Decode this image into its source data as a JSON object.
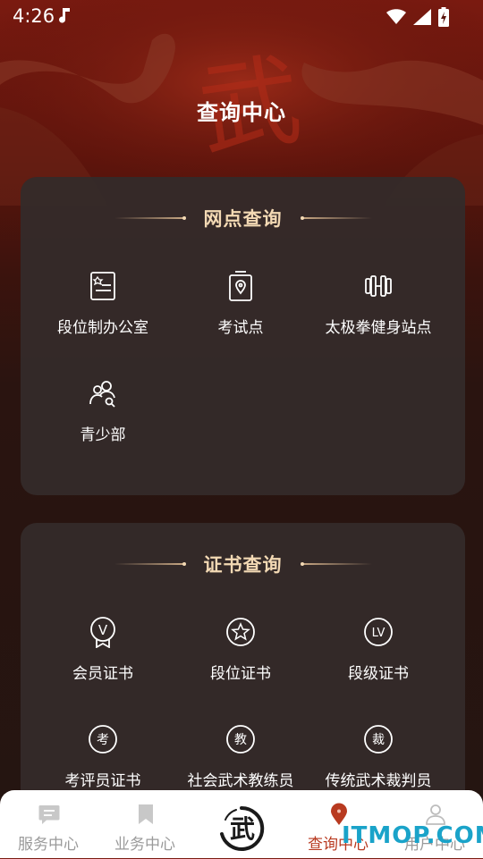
{
  "status_bar": {
    "time": "4:26"
  },
  "header": {
    "title": "查询中心"
  },
  "outlet_section": {
    "title": "网点查询",
    "items": [
      {
        "label": "段位制办公室",
        "icon": "id-card-icon"
      },
      {
        "label": "考试点",
        "icon": "location-pin-icon"
      },
      {
        "label": "太极拳健身站点",
        "icon": "dumbbell-icon"
      },
      {
        "label": "青少部",
        "icon": "youth-group-icon"
      }
    ]
  },
  "certificate_section": {
    "title": "证书查询",
    "items": [
      {
        "label": "会员证书",
        "icon": "medal-v-icon",
        "glyph": "V"
      },
      {
        "label": "段位证书",
        "icon": "star-badge-icon",
        "glyph": ""
      },
      {
        "label": "段级证书",
        "icon": "lv-badge-icon",
        "glyph": "LV"
      },
      {
        "label": "考评员证书",
        "icon": "examiner-badge-icon",
        "glyph": "考"
      },
      {
        "label": "社会武术教练员",
        "icon": "coach-badge-icon",
        "glyph": "教"
      },
      {
        "label": "传统武术裁判员",
        "icon": "referee-badge-icon",
        "glyph": "裁"
      }
    ]
  },
  "tabbar": {
    "tabs": [
      {
        "label": "服务中心",
        "icon": "chat-bubble-icon",
        "active": false
      },
      {
        "label": "业务中心",
        "icon": "bookmark-icon",
        "active": false
      },
      {
        "label": "",
        "icon": "wu-logo-icon",
        "active": false
      },
      {
        "label": "查询中心",
        "icon": "map-pin-icon",
        "active": true
      },
      {
        "label": "用户中心",
        "icon": "user-icon",
        "active": false
      }
    ],
    "center_logo_text": "武"
  },
  "background": {
    "calligraphy": "武"
  },
  "watermark": {
    "text": "ITMOP.COM"
  },
  "colors": {
    "accent": "#b83a20",
    "title_gold": "#f3d9b4",
    "card_bg": "#342b2a"
  }
}
